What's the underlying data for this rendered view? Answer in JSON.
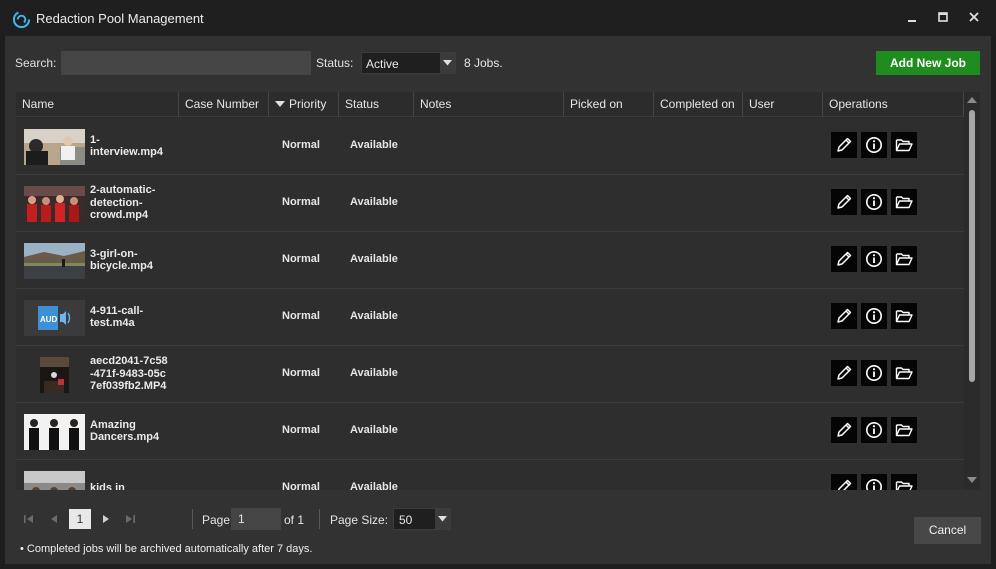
{
  "window": {
    "title": "Redaction Pool Management",
    "controls": [
      "minimize",
      "maximize",
      "close"
    ]
  },
  "toolbar": {
    "search_label": "Search:",
    "search_value": "",
    "status_label": "Status:",
    "status_value": "Active",
    "jobs_count": "8 Jobs.",
    "add_button": "Add New Job",
    "add_button_color": "#1e8c1e"
  },
  "table": {
    "columns": [
      "Name",
      "Case Number",
      "Priority",
      "Status",
      "Notes",
      "Picked on",
      "Completed on",
      "User",
      "Operations"
    ],
    "sort_column": "Priority",
    "rows": [
      {
        "name": "1-\ninterview.mp4",
        "case_number": "",
        "priority": "Normal",
        "status": "Available",
        "notes": "",
        "picked_on": "",
        "completed_on": "",
        "user": "",
        "thumbnail": "interview"
      },
      {
        "name": "2-automatic-\ndetection-\ncrowd.mp4",
        "case_number": "",
        "priority": "Normal",
        "status": "Available",
        "notes": "",
        "picked_on": "",
        "completed_on": "",
        "user": "",
        "thumbnail": "crowd"
      },
      {
        "name": "3-girl-on-\nbicycle.mp4",
        "case_number": "",
        "priority": "Normal",
        "status": "Available",
        "notes": "",
        "picked_on": "",
        "completed_on": "",
        "user": "",
        "thumbnail": "road"
      },
      {
        "name": "4-911-call-\ntest.m4a",
        "case_number": "",
        "priority": "Normal",
        "status": "Available",
        "notes": "",
        "picked_on": "",
        "completed_on": "",
        "user": "",
        "thumbnail": "audio"
      },
      {
        "name": "aecd2041-7c58\n-471f-9483-05c\n7ef039fb2.MP4",
        "case_number": "",
        "priority": "Normal",
        "status": "Available",
        "notes": "",
        "picked_on": "",
        "completed_on": "",
        "user": "",
        "thumbnail": "portrait"
      },
      {
        "name": "Amazing\nDancers.mp4",
        "case_number": "",
        "priority": "Normal",
        "status": "Available",
        "notes": "",
        "picked_on": "",
        "completed_on": "",
        "user": "",
        "thumbnail": "dancers"
      },
      {
        "name": "kids in",
        "case_number": "",
        "priority": "Normal",
        "status": "Available",
        "notes": "",
        "picked_on": "",
        "completed_on": "",
        "user": "",
        "thumbnail": "kids"
      }
    ],
    "operation_icons": [
      "pencil-icon",
      "info-icon",
      "folder-open-icon"
    ]
  },
  "pager": {
    "current_page": "1",
    "page_label": "Page",
    "page_input": "1",
    "of_label": "of 1",
    "page_size_label": "Page Size:",
    "page_size_value": "50"
  },
  "footer": {
    "cancel_button": "Cancel",
    "note": "• Completed jobs will be archived automatically after 7 days."
  }
}
